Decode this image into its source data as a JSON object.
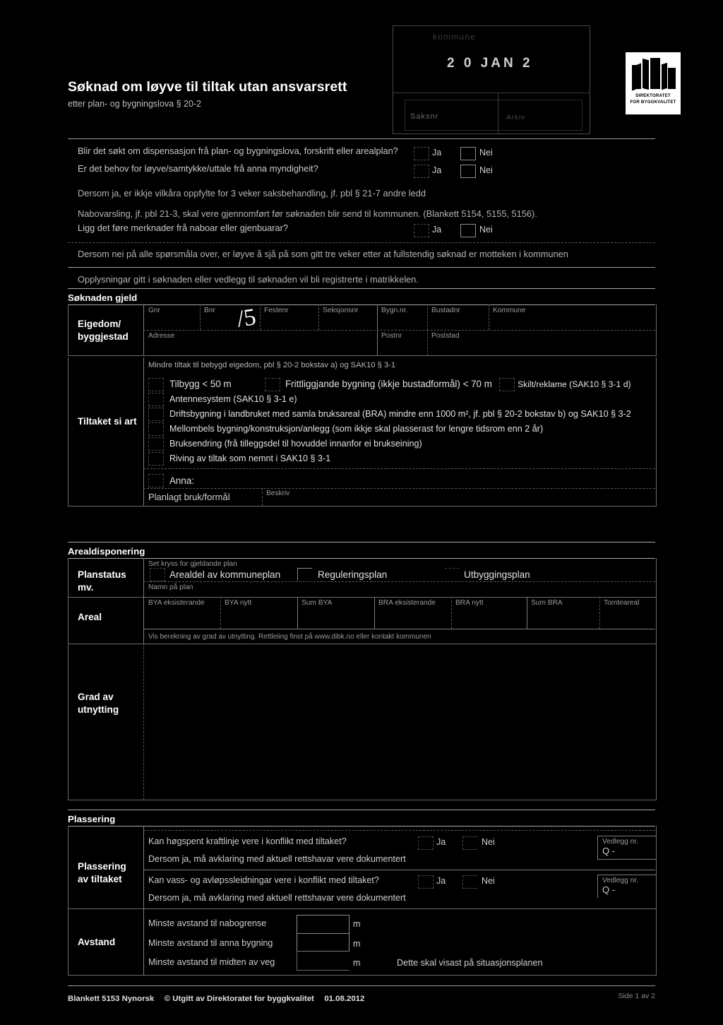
{
  "header": {
    "title": "Søknad om løyve til tiltak utan ansvarsrett",
    "subtitle": "etter plan- og bygningslova § 20-2"
  },
  "stamp": {
    "municipality": "kommune",
    "date": "2 0  JAN  2",
    "field_left": "Saksnr",
    "field_right": "Arkiv"
  },
  "logo": {
    "line1": "DIREKTORATET",
    "line2": "FOR BYGGKVALITET"
  },
  "questions": {
    "q1": "Blir det søkt om dispensasjon frå plan- og bygningslova, forskrift eller arealplan?",
    "q2": "Er det behov for løyve/samtykke/uttale frå anna myndigheit?",
    "note1": "Dersom ja, er ikkje vilkåra oppfylte for 3 veker saksbehandling, jf. pbl § 21-7 andre ledd",
    "note2": "Nabovarsling, jf. pbl 21-3, skal vere gjennomført før søknaden blir send til kommunen. (Blankett 5154, 5155, 5156).",
    "q3": "Ligg det føre merknader frå naboar eller gjenbuarar?",
    "note3": "Dersom nei på alle spørsmåla over, er løyve å sjå på som gitt tre veker etter at fullstendig søknad er motteken i kommunen",
    "note4": "Opplysningar gitt i søknaden eller vedlegg til søknaden vil bli registrerte i matrikkelen.",
    "yes": "Ja",
    "no": "Nei"
  },
  "soknaden_gjeld": {
    "heading": "Søknaden gjeld",
    "row_label_line1": "Eigedom/",
    "row_label_line2": "byggjestad",
    "columns": [
      "Gnr",
      "Bnr",
      "Festenr",
      "Seksjonsnr",
      "Bygn.nr.",
      "Bustadnr",
      "Kommune"
    ],
    "address_label": "Adresse",
    "postnr_label": "Postnr",
    "poststad_label": "Poststad",
    "handwritten_value": "/5"
  },
  "tiltaket": {
    "row_label": "Tiltaket si art",
    "intro": "Mindre tiltak til bebygd eigedom, pbl § 20-2 bokstav a) og SAK10 § 3-1",
    "options_inline": [
      "Tilbygg < 50 m",
      "Frittliggjande bygning (ikkje bustadformål) < 70 m",
      "Skilt/reklame (SAK10 § 3-1 d)"
    ],
    "options": [
      "Antennesystem (SAK10 § 3-1 e)",
      "Driftsbygning i landbruket med samla bruksareal (BRA) mindre enn 1000 m², jf. pbl § 20-2 bokstav b) og SAK10 § 3-2",
      "Mellombels bygning/konstruksjon/anlegg (som ikkje skal plasserast for lengre tidsrom enn 2 år)",
      "Bruksendring (frå tilleggsdel til hovuddel innanfor ei brukseining)",
      "Riving av tiltak som nemnt i SAK10 § 3-1",
      "Anna:"
    ],
    "planlagt_bruk_label": "Planlagt bruk/formål",
    "beskriv_label": "Beskriv"
  },
  "arealdisponering": {
    "heading": "Arealdisponering",
    "planstatus_label_line1": "Planstatus",
    "planstatus_label_line2": "mv.",
    "hint": "Set kryss for gjeldande plan",
    "plan_options": [
      "Arealdel av kommuneplan",
      "Reguleringsplan",
      "Utbyggingsplan"
    ],
    "plan_name_label": "Namn på plan",
    "areal_label": "Areal",
    "areal_columns": [
      "BYA eksisterande",
      "BYA nytt",
      "Sum BYA",
      "BRA eksisterande",
      "BRA nytt",
      "Sum BRA",
      "Tomteareal"
    ],
    "areal_note": "Vis berekning av grad av utnytting. Rettleiing finst på www.dibk.no eller kontakt kommunen",
    "grad_label_line1": "Grad av",
    "grad_label_line2": "utnytting"
  },
  "plassering": {
    "heading": "Plassering",
    "row_label_line1": "Plassering",
    "row_label_line2": "av tiltaket",
    "q1": "Kan høgspent kraftlinje vere i konflikt med tiltaket?",
    "q1_note": "Dersom ja, må avklaring med aktuell rettshavar vere dokumentert",
    "q2": "Kan vass- og avløpssleidningar vere i konflikt med tiltaket?",
    "q2_note": "Dersom ja, må avklaring med aktuell rettshavar vere dokumentert",
    "yes": "Ja",
    "no": "Nei",
    "vedlegg_label": "Vedlegg nr.",
    "vedlegg_value": "Q -"
  },
  "avstand": {
    "row_label": "Avstand",
    "rows": [
      {
        "label": "Minste avstand til nabogrense",
        "unit": "m",
        "note": ""
      },
      {
        "label": "Minste avstand til anna bygning",
        "unit": "m",
        "note": ""
      },
      {
        "label": "Minste avstand til midten av veg",
        "unit": "m",
        "note": "Dette skal visast på situasjonsplanen"
      }
    ]
  },
  "footer": {
    "blankett": "Blankett 5153 Nynorsk",
    "publisher": "© Utgitt av Direktoratet for byggkvalitet",
    "date": "01.08.2012",
    "page": "Side 1 av 2"
  }
}
